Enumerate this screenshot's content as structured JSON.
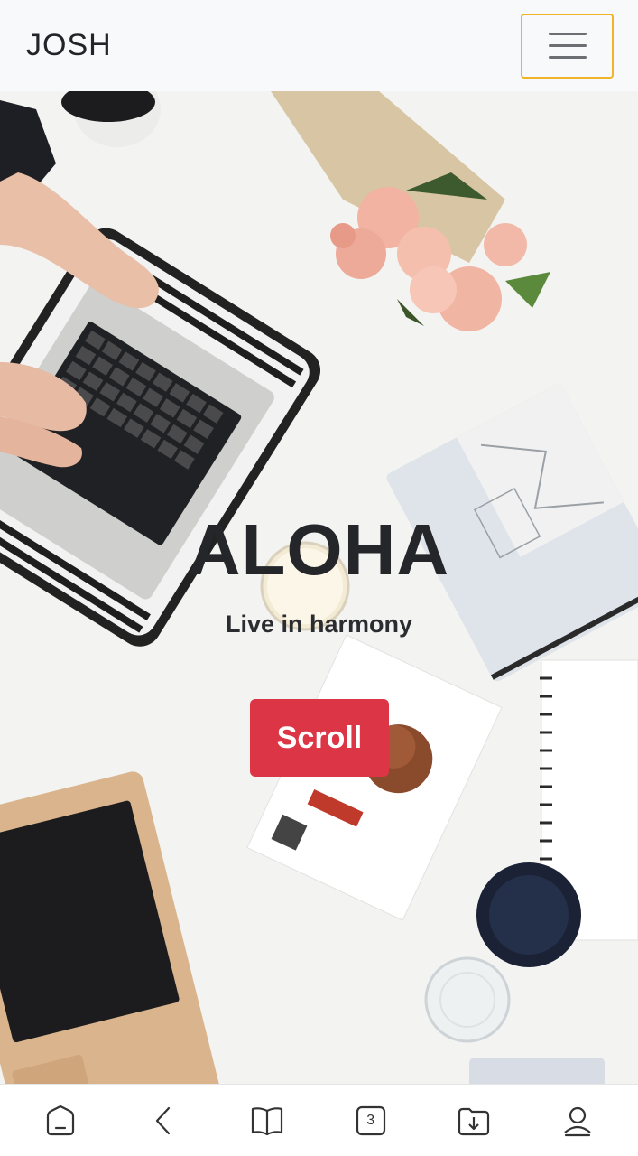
{
  "header": {
    "brand": "JOSH",
    "menu_icon": "hamburger-menu-icon",
    "menu_focus_color": "#f0b429"
  },
  "hero": {
    "title": "ALOHA",
    "subtitle": "Live in harmony",
    "scroll_label": "Scroll",
    "scroll_color": "#dc3545"
  },
  "bottom_nav": {
    "home_icon": "home-icon",
    "back_icon": "back-arrow-icon",
    "reader_icon": "open-book-icon",
    "tabs_count": "3",
    "downloads_icon": "download-folder-icon",
    "profile_icon": "profile-icon"
  }
}
